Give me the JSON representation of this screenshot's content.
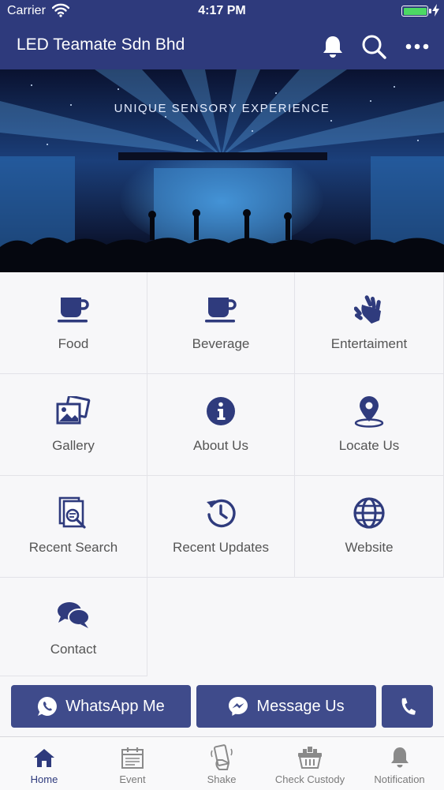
{
  "status_bar": {
    "carrier": "Carrier",
    "time": "4:17 PM"
  },
  "header": {
    "title": "LED Teamate Sdn Bhd",
    "icons": [
      "bell-icon",
      "search-icon",
      "more-icon"
    ]
  },
  "banner": {
    "tagline": "UNIQUE SENSORY EXPERIENCE"
  },
  "menu": [
    {
      "label": "Food",
      "icon": "coffee-cup-icon"
    },
    {
      "label": "Beverage",
      "icon": "coffee-cup-icon"
    },
    {
      "label": "Entertaiment",
      "icon": "sign-language-icon"
    },
    {
      "label": "Gallery",
      "icon": "gallery-icon"
    },
    {
      "label": "About Us",
      "icon": "info-icon"
    },
    {
      "label": "Locate Us",
      "icon": "location-pin-icon"
    },
    {
      "label": "Recent Search",
      "icon": "document-search-icon"
    },
    {
      "label": "Recent Updates",
      "icon": "history-icon"
    },
    {
      "label": "Website",
      "icon": "globe-icon"
    },
    {
      "label": "Contact",
      "icon": "chat-bubbles-icon"
    }
  ],
  "actions": {
    "whatsapp": "WhatsApp Me",
    "messenger": "Message Us",
    "call_icon": "phone-icon"
  },
  "tabs": [
    {
      "label": "Home",
      "icon": "home-icon",
      "active": true
    },
    {
      "label": "Event",
      "icon": "calendar-icon"
    },
    {
      "label": "Shake",
      "icon": "shake-phone-icon"
    },
    {
      "label": "Check Custody",
      "icon": "basket-icon"
    },
    {
      "label": "Notification",
      "icon": "bell-icon"
    }
  ],
  "colors": {
    "primary": "#2e3a7c",
    "button": "#3f4b8b",
    "icon": "#2f3b7d",
    "battery": "#4cd964"
  }
}
